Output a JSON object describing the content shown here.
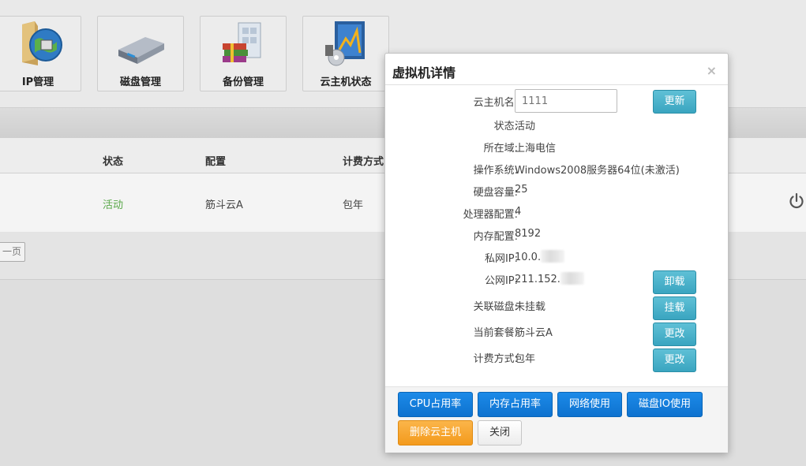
{
  "tiles": [
    {
      "label": "IP管理",
      "icon": "folder-globe-icon"
    },
    {
      "label": "磁盘管理",
      "icon": "hard-disk-icon"
    },
    {
      "label": "备份管理",
      "icon": "backup-books-icon"
    },
    {
      "label": "云主机状态",
      "icon": "monitor-chart-icon"
    }
  ],
  "table": {
    "headers": {
      "status": "状态",
      "config": "配置",
      "billing": "计费方式"
    },
    "row": {
      "status": "活动",
      "config": "筋斗云A",
      "billing": "包年"
    },
    "prev_page": "一页"
  },
  "modal": {
    "title": "虚拟机详情",
    "close": "×",
    "fields": {
      "name": {
        "label": "云主机名:",
        "value": "1111",
        "placeholder": "1111"
      },
      "status": {
        "label": "状态:",
        "value": "活动"
      },
      "region": {
        "label": "所在域:",
        "value": "上海电信"
      },
      "os": {
        "label": "操作系统:",
        "value": "Windows2008服务器64位(未激活)"
      },
      "disk": {
        "label": "硬盘容量:",
        "value": "25"
      },
      "cpu": {
        "label": "处理器配置:",
        "value": "4"
      },
      "memory": {
        "label": "内存配置:",
        "value": "8192"
      },
      "private_ip": {
        "label": "私网IP:",
        "value": "10.0."
      },
      "public_ip": {
        "label": "公网IP:",
        "value": "211.152."
      },
      "attached_disk": {
        "label": "关联磁盘:",
        "value": "未挂载"
      },
      "package": {
        "label": "当前套餐:",
        "value": "筋斗云A"
      },
      "billing": {
        "label": "计费方式:",
        "value": "包年"
      }
    },
    "buttons": {
      "update": "更新",
      "unmount": "卸载",
      "mount": "挂载",
      "change_package": "更改",
      "change_billing": "更改",
      "cpu_usage": "CPU占用率",
      "memory_usage": "内存占用率",
      "network_usage": "网络使用",
      "disk_io": "磁盘IO使用",
      "delete": "删除云主机",
      "close": "关闭"
    }
  },
  "colors": {
    "primary_blue": "#0e72cf",
    "teal": "#3aa5c0",
    "orange": "#f39a1c",
    "active_green": "#5aa84a"
  }
}
